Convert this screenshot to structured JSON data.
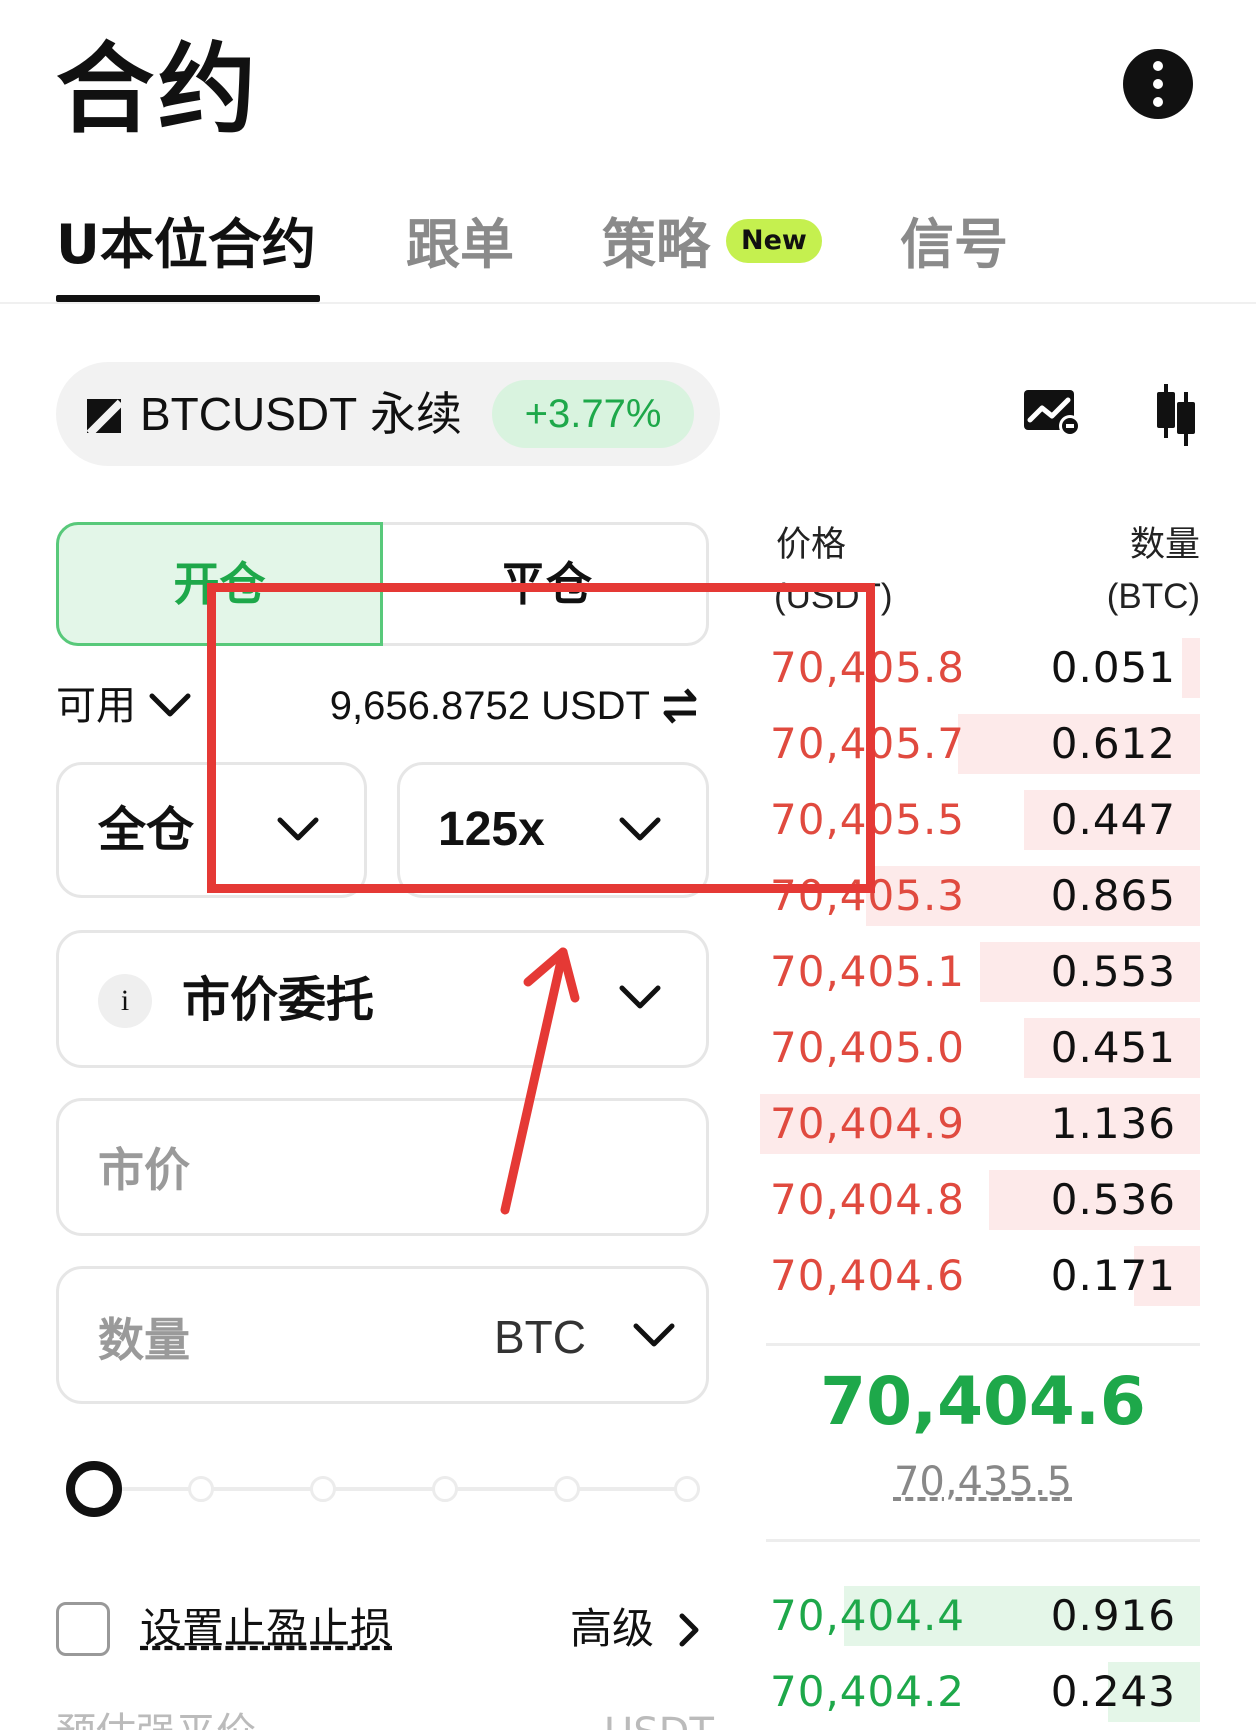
{
  "header": {
    "title": "合约"
  },
  "tabs": [
    {
      "label": "U本位合约",
      "active": true
    },
    {
      "label": "跟单",
      "active": false
    },
    {
      "label": "策略",
      "active": false,
      "badge": "New"
    },
    {
      "label": "信号",
      "active": false
    }
  ],
  "symbol": {
    "name": "BTCUSDT",
    "type": "永续",
    "change": "+3.77%"
  },
  "trade_side": {
    "open": "开仓",
    "close": "平仓",
    "selected": "open"
  },
  "available": {
    "label": "可用",
    "value": "9,656.8752 USDT"
  },
  "margin_mode": {
    "label": "全仓"
  },
  "leverage": {
    "label": "125x"
  },
  "order_type": {
    "info": "i",
    "label": "市价委托"
  },
  "price_input": {
    "placeholder": "市价"
  },
  "quantity_input": {
    "placeholder": "数量",
    "unit": "BTC"
  },
  "slider": {
    "value_percent": 0,
    "stops": 6
  },
  "tpsl": {
    "label": "设置止盈止损",
    "checked": false,
    "advanced": "高级"
  },
  "cut_off": {
    "left": "预估强平价",
    "right": "USDT"
  },
  "orderbook": {
    "price_header": "价格",
    "price_unit": "(USDT)",
    "qty_header": "数量",
    "qty_unit": "(BTC)",
    "asks": [
      {
        "price": "70,405.8",
        "qty": "0.051",
        "depth": 0.04
      },
      {
        "price": "70,405.7",
        "qty": "0.612",
        "depth": 0.55
      },
      {
        "price": "70,405.5",
        "qty": "0.447",
        "depth": 0.4
      },
      {
        "price": "70,405.3",
        "qty": "0.865",
        "depth": 0.76
      },
      {
        "price": "70,405.1",
        "qty": "0.553",
        "depth": 0.5
      },
      {
        "price": "70,405.0",
        "qty": "0.451",
        "depth": 0.4
      },
      {
        "price": "70,404.9",
        "qty": "1.136",
        "depth": 1.0
      },
      {
        "price": "70,404.8",
        "qty": "0.536",
        "depth": 0.48
      },
      {
        "price": "70,404.6",
        "qty": "0.171",
        "depth": 0.15
      }
    ],
    "last_price": "70,404.6",
    "mark_price": "70,435.5",
    "bids": [
      {
        "price": "70,404.4",
        "qty": "0.916",
        "depth": 0.81
      },
      {
        "price": "70,404.2",
        "qty": "0.243",
        "depth": 0.21
      }
    ]
  },
  "colors": {
    "buy": "#1ea84a",
    "sell": "#e04a3f",
    "badge": "#c5f04f",
    "annotation": "#e53935"
  },
  "icons": [
    "more-vertical-icon",
    "symbol-logo-icon",
    "chart-settings-icon",
    "kline-icon",
    "chevron-down-icon",
    "swap-icon",
    "chevron-right-icon"
  ]
}
